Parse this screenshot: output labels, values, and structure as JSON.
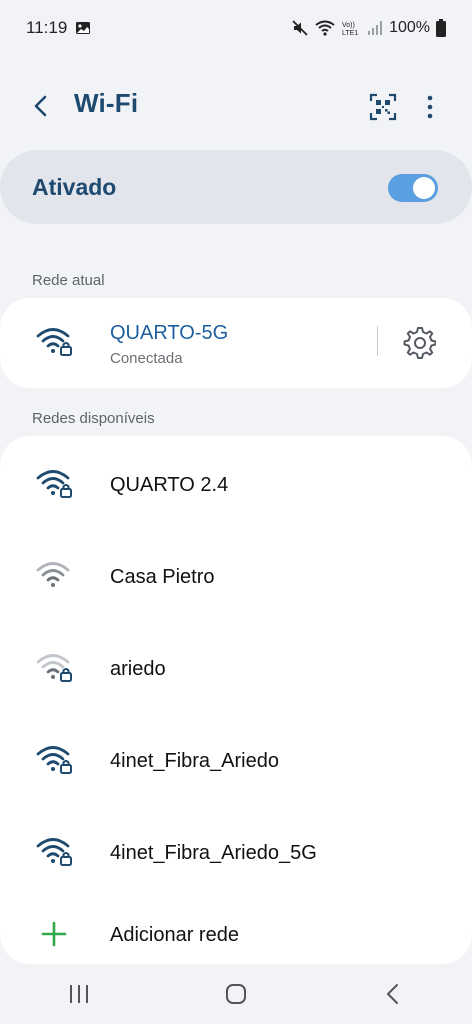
{
  "status_bar": {
    "time": "11:19",
    "battery_text": "100%",
    "icons": [
      "image-icon",
      "mute-icon",
      "wifi-icon",
      "volte-icon",
      "signal-icon",
      "battery-icon"
    ],
    "volte_text": "VoLTE1"
  },
  "header": {
    "title": "Wi-Fi",
    "back_icon": "chevron-left-icon",
    "qr_icon": "qr-scan-icon",
    "more_icon": "more-vertical-icon"
  },
  "wifi_toggle": {
    "label": "Ativado",
    "on": true,
    "accent_color": "#5a9fe0"
  },
  "current_section": {
    "label": "Rede atual",
    "network": {
      "name": "QUARTO-5G",
      "status": "Conectada",
      "secured": true,
      "signal": "full"
    }
  },
  "available_section": {
    "label": "Redes disponíveis",
    "networks": [
      {
        "name": "QUARTO 2.4",
        "secured": true,
        "signal": "full"
      },
      {
        "name": "Casa Pietro",
        "secured": false,
        "signal": "weak"
      },
      {
        "name": "ariedo",
        "secured": true,
        "signal": "weak"
      },
      {
        "name": "4inet_Fibra_Ariedo",
        "secured": true,
        "signal": "full"
      },
      {
        "name": "4inet_Fibra_Ariedo_5G",
        "secured": true,
        "signal": "full"
      }
    ],
    "add_label": "Adicionar rede"
  },
  "nav_bar": {
    "items": [
      "recents-icon",
      "home-icon",
      "back-icon"
    ]
  },
  "colors": {
    "title": "#1e4a70",
    "wifi_strong": "#1e4a70",
    "wifi_weak": "#b0b4ba",
    "add_green": "#2ea84a"
  }
}
